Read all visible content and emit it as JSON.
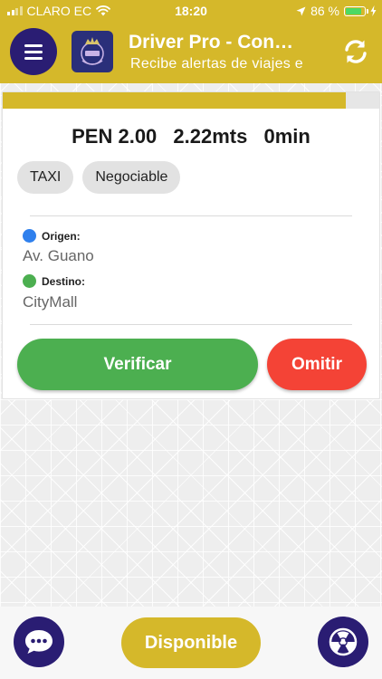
{
  "status_bar": {
    "carrier": "CLARO EC",
    "time": "18:20",
    "battery": "86 %",
    "battery_level": 0.86
  },
  "header": {
    "title": "Driver Pro - Con…",
    "subtitle": "Recibe alertas de viajes e",
    "color": "#d5b82a"
  },
  "icons": {
    "menu": "menu-icon",
    "logo": "app-logo",
    "refresh": "refresh-icon",
    "chat": "chat-icon",
    "radar": "radiation-icon"
  },
  "trip": {
    "progress": 0.91,
    "price": "PEN 2.00",
    "distance": "2.22mts",
    "duration": "0min",
    "chips": [
      "TAXI",
      "Negociable"
    ],
    "origin_label": "Origen:",
    "origin_value": "Av. Guano",
    "destination_label": "Destino:",
    "destination_value": "CityMall",
    "verify_label": "Verificar",
    "skip_label": "Omitir"
  },
  "bottom": {
    "available_label": "Disponible"
  },
  "colors": {
    "accent": "#d5b82a",
    "navy": "#2a1d73",
    "verify": "#4caf50",
    "skip": "#f44336",
    "origin_dot": "#2f80ed",
    "destination_dot": "#4caf50"
  }
}
